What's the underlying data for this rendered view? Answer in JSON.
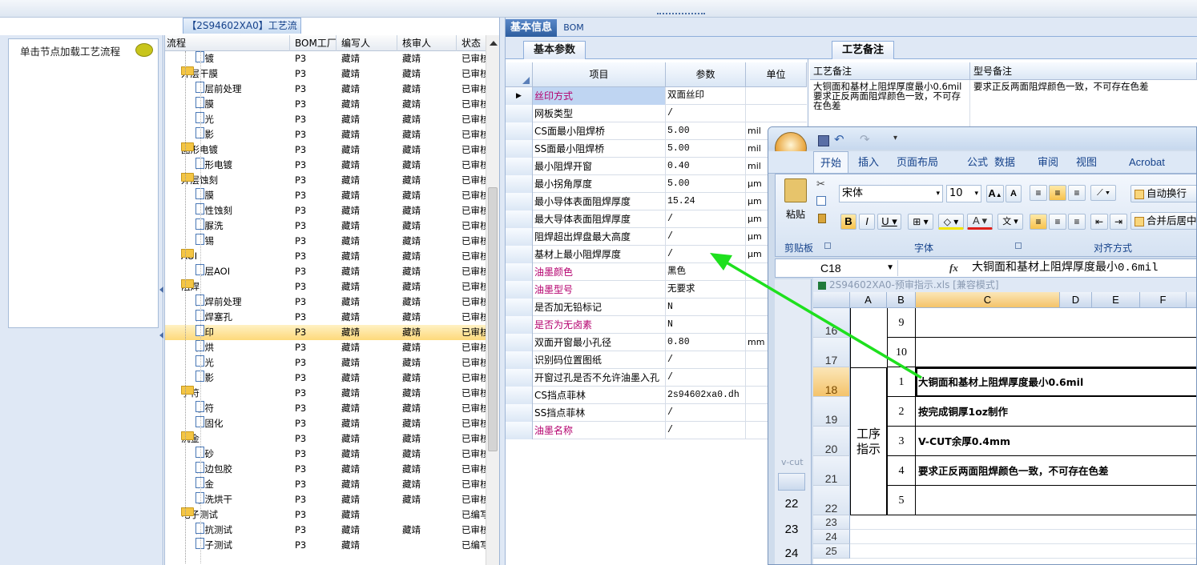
{
  "top_tabs": {
    "process_title": "【2S94602XA0】工艺流程",
    "basic_info": "基本信息",
    "bom": "BOM"
  },
  "left_panel": {
    "load_hint": "单击节点加载工艺流程"
  },
  "tree": {
    "headers": [
      "流程",
      "BOM工厂",
      "编写人",
      "核审人",
      "状态"
    ],
    "rows": [
      {
        "level": 1,
        "type": "doc",
        "name": "板镀",
        "bom": "P3",
        "writer": "藏靖",
        "reviewer": "藏靖",
        "status": "已审核"
      },
      {
        "level": 0,
        "type": "folder",
        "name": "外层干膜",
        "bom": "P3",
        "writer": "藏靖",
        "reviewer": "藏靖",
        "status": "已审核"
      },
      {
        "level": 1,
        "type": "doc",
        "name": "外层前处理",
        "bom": "P3",
        "writer": "藏靖",
        "reviewer": "藏靖",
        "status": "已审核"
      },
      {
        "level": 1,
        "type": "doc",
        "name": "贴膜",
        "bom": "P3",
        "writer": "藏靖",
        "reviewer": "藏靖",
        "status": "已审核"
      },
      {
        "level": 1,
        "type": "doc",
        "name": "曝光",
        "bom": "P3",
        "writer": "藏靖",
        "reviewer": "藏靖",
        "status": "已审核"
      },
      {
        "level": 1,
        "type": "doc",
        "name": "显影",
        "bom": "P3",
        "writer": "藏靖",
        "reviewer": "藏靖",
        "status": "已审核"
      },
      {
        "level": 0,
        "type": "folder",
        "name": "图形电镀",
        "bom": "P3",
        "writer": "藏靖",
        "reviewer": "藏靖",
        "status": "已审核"
      },
      {
        "level": 1,
        "type": "doc",
        "name": "图形电镀",
        "bom": "P3",
        "writer": "藏靖",
        "reviewer": "藏靖",
        "status": "已审核"
      },
      {
        "level": 0,
        "type": "folder",
        "name": "外层蚀刻",
        "bom": "P3",
        "writer": "藏靖",
        "reviewer": "藏靖",
        "status": "已审核"
      },
      {
        "level": 1,
        "type": "doc",
        "name": "退膜",
        "bom": "P3",
        "writer": "藏靖",
        "reviewer": "藏靖",
        "status": "已审核"
      },
      {
        "level": 1,
        "type": "doc",
        "name": "碱性蚀刻",
        "bom": "P3",
        "writer": "藏靖",
        "reviewer": "藏靖",
        "status": "已审核"
      },
      {
        "level": 1,
        "type": "doc",
        "name": "硫脲洗",
        "bom": "P3",
        "writer": "藏靖",
        "reviewer": "藏靖",
        "status": "已审核"
      },
      {
        "level": 1,
        "type": "doc",
        "name": "退锡",
        "bom": "P3",
        "writer": "藏靖",
        "reviewer": "藏靖",
        "status": "已审核"
      },
      {
        "level": 0,
        "type": "folder",
        "name": "AOI",
        "bom": "P3",
        "writer": "藏靖",
        "reviewer": "藏靖",
        "status": "已审核"
      },
      {
        "level": 1,
        "type": "doc",
        "name": "外层AOI",
        "bom": "P3",
        "writer": "藏靖",
        "reviewer": "藏靖",
        "status": "已审核"
      },
      {
        "level": 0,
        "type": "folder",
        "name": "阻焊",
        "bom": "P3",
        "writer": "藏靖",
        "reviewer": "藏靖",
        "status": "已审核"
      },
      {
        "level": 1,
        "type": "doc",
        "name": "阻焊前处理",
        "bom": "P3",
        "writer": "藏靖",
        "reviewer": "藏靖",
        "status": "已审核"
      },
      {
        "level": 1,
        "type": "doc",
        "name": "阻焊塞孔",
        "bom": "P3",
        "writer": "藏靖",
        "reviewer": "藏靖",
        "status": "已审核"
      },
      {
        "level": 1,
        "type": "doc",
        "name": "丝印",
        "bom": "P3",
        "writer": "藏靖",
        "reviewer": "藏靖",
        "status": "已审核",
        "selected": true
      },
      {
        "level": 1,
        "type": "doc",
        "name": "预烘",
        "bom": "P3",
        "writer": "藏靖",
        "reviewer": "藏靖",
        "status": "已审核"
      },
      {
        "level": 1,
        "type": "doc",
        "name": "曝光",
        "bom": "P3",
        "writer": "藏靖",
        "reviewer": "藏靖",
        "status": "已审核"
      },
      {
        "level": 1,
        "type": "doc",
        "name": "显影",
        "bom": "P3",
        "writer": "藏靖",
        "reviewer": "藏靖",
        "status": "已审核"
      },
      {
        "level": 0,
        "type": "folder",
        "name": "字符",
        "bom": "P3",
        "writer": "藏靖",
        "reviewer": "藏靖",
        "status": "已审核"
      },
      {
        "level": 1,
        "type": "doc",
        "name": "字符",
        "bom": "P3",
        "writer": "藏靖",
        "reviewer": "藏靖",
        "status": "已审核"
      },
      {
        "level": 1,
        "type": "doc",
        "name": "终固化",
        "bom": "P3",
        "writer": "藏靖",
        "reviewer": "藏靖",
        "status": "已审核"
      },
      {
        "level": 0,
        "type": "folder",
        "name": "沉金",
        "bom": "P3",
        "writer": "藏靖",
        "reviewer": "藏靖",
        "status": "已审核"
      },
      {
        "level": 1,
        "type": "doc",
        "name": "喷砂",
        "bom": "P3",
        "writer": "藏靖",
        "reviewer": "藏靖",
        "status": "已审核"
      },
      {
        "level": 1,
        "type": "doc",
        "name": "板边包胶",
        "bom": "P3",
        "writer": "藏靖",
        "reviewer": "藏靖",
        "status": "已审核"
      },
      {
        "level": 1,
        "type": "doc",
        "name": "沉金",
        "bom": "P3",
        "writer": "藏靖",
        "reviewer": "藏靖",
        "status": "已审核"
      },
      {
        "level": 1,
        "type": "doc",
        "name": "水洗烘干",
        "bom": "P3",
        "writer": "藏靖",
        "reviewer": "藏靖",
        "status": "已审核"
      },
      {
        "level": 0,
        "type": "folder",
        "name": "电子测试",
        "bom": "P3",
        "writer": "藏靖",
        "reviewer": "",
        "status": "已编写"
      },
      {
        "level": 1,
        "type": "doc",
        "name": "阻抗测试",
        "bom": "P3",
        "writer": "藏靖",
        "reviewer": "藏靖",
        "status": "已审核"
      },
      {
        "level": 1,
        "type": "doc",
        "name": "电子测试",
        "bom": "P3",
        "writer": "藏靖",
        "reviewer": "",
        "status": "已编写"
      }
    ]
  },
  "params": {
    "tab": "基本参数",
    "headers": [
      "项目",
      "参数",
      "单位"
    ],
    "rows": [
      {
        "item": "丝印方式",
        "value": "双面丝印",
        "unit": "",
        "highlight": true,
        "current": true
      },
      {
        "item": "网板类型",
        "value": "/",
        "unit": ""
      },
      {
        "item": "CS面最小阻焊桥",
        "value": "5.00",
        "unit": "mil"
      },
      {
        "item": "SS面最小阻焊桥",
        "value": "5.00",
        "unit": "mil"
      },
      {
        "item": "最小阻焊开窗",
        "value": "0.40",
        "unit": "mil"
      },
      {
        "item": "最小拐角厚度",
        "value": "5.00",
        "unit": "μm"
      },
      {
        "item": "最小导体表面阻焊厚度",
        "value": "15.24",
        "unit": "μm"
      },
      {
        "item": "最大导体表面阻焊厚度",
        "value": "/",
        "unit": "μm"
      },
      {
        "item": "阻焊超出焊盘最大高度",
        "value": "/",
        "unit": "μm"
      },
      {
        "item": "基材上最小阻焊厚度",
        "value": "/",
        "unit": "μm"
      },
      {
        "item": "油墨颜色",
        "value": "黑色",
        "unit": "",
        "highlight": true
      },
      {
        "item": "油墨型号",
        "value": "无要求",
        "unit": "",
        "highlight": true
      },
      {
        "item": "是否加无铅标记",
        "value": "N",
        "unit": ""
      },
      {
        "item": "是否为无卤素",
        "value": "N",
        "unit": "",
        "highlight": true
      },
      {
        "item": "双面开窗最小孔径",
        "value": "0.80",
        "unit": "mm"
      },
      {
        "item": "识别码位置图纸",
        "value": "/",
        "unit": ""
      },
      {
        "item": "开窗过孔是否不允许油墨入孔",
        "value": "/",
        "unit": ""
      },
      {
        "item": "CS挡点菲林",
        "value": "2s94602xa0.dh",
        "unit": ""
      },
      {
        "item": "SS挡点菲林",
        "value": "/",
        "unit": ""
      },
      {
        "item": "油墨名称",
        "value": "/",
        "unit": "",
        "highlight": true
      }
    ]
  },
  "remarks": {
    "tab": "工艺备注",
    "headers": [
      "工艺备注",
      "型号备注"
    ],
    "process_note": "大铜面和基材上阻焊厚度最小0.6mil　要求正反两面阻焊颜色一致，不可存在色差",
    "model_note": "要求正反两面阻焊颜色一致，不可存在色差"
  },
  "excel": {
    "ribbon_tabs": [
      "开始",
      "插入",
      "页面布局",
      "公式",
      "数据",
      "审阅",
      "视图",
      "Acrobat"
    ],
    "font_name": "宋体",
    "font_size": "10",
    "paste": "粘贴",
    "clipboard": "剪贴板",
    "font_group": "字体",
    "align_group": "对齐方式",
    "wrap": "自动换行",
    "merge": "合并后居中",
    "name_box": "C18",
    "fx": "fx",
    "formula": "大铜面和基材上阻焊厚度最小0.6mil",
    "doc_title": "2S94602XA0-预审指示.xls [兼容模式]",
    "cols": [
      "A",
      "B",
      "C",
      "D",
      "E",
      "F"
    ],
    "rows": [
      {
        "r": "16",
        "b": "9",
        "c": ""
      },
      {
        "r": "17",
        "b": "10",
        "c": ""
      },
      {
        "r": "18",
        "b": "1",
        "c": "大铜面和基材上阻焊厚度最小0.6mil"
      },
      {
        "r": "19",
        "b": "2",
        "c": "按完成铜厚1oz制作"
      },
      {
        "r": "20",
        "b": "3",
        "c": "V-CUT余厚0.4mm"
      },
      {
        "r": "21",
        "b": "4",
        "c": "要求正反两面阻焊颜色一致，不可存在色差"
      },
      {
        "r": "22",
        "b": "5",
        "c": ""
      }
    ],
    "merged_label": "工序指示",
    "tail_rows": [
      "23",
      "24",
      "25"
    ],
    "back_rows": [
      "22",
      "23",
      "24"
    ],
    "back_label": "v-cut"
  }
}
